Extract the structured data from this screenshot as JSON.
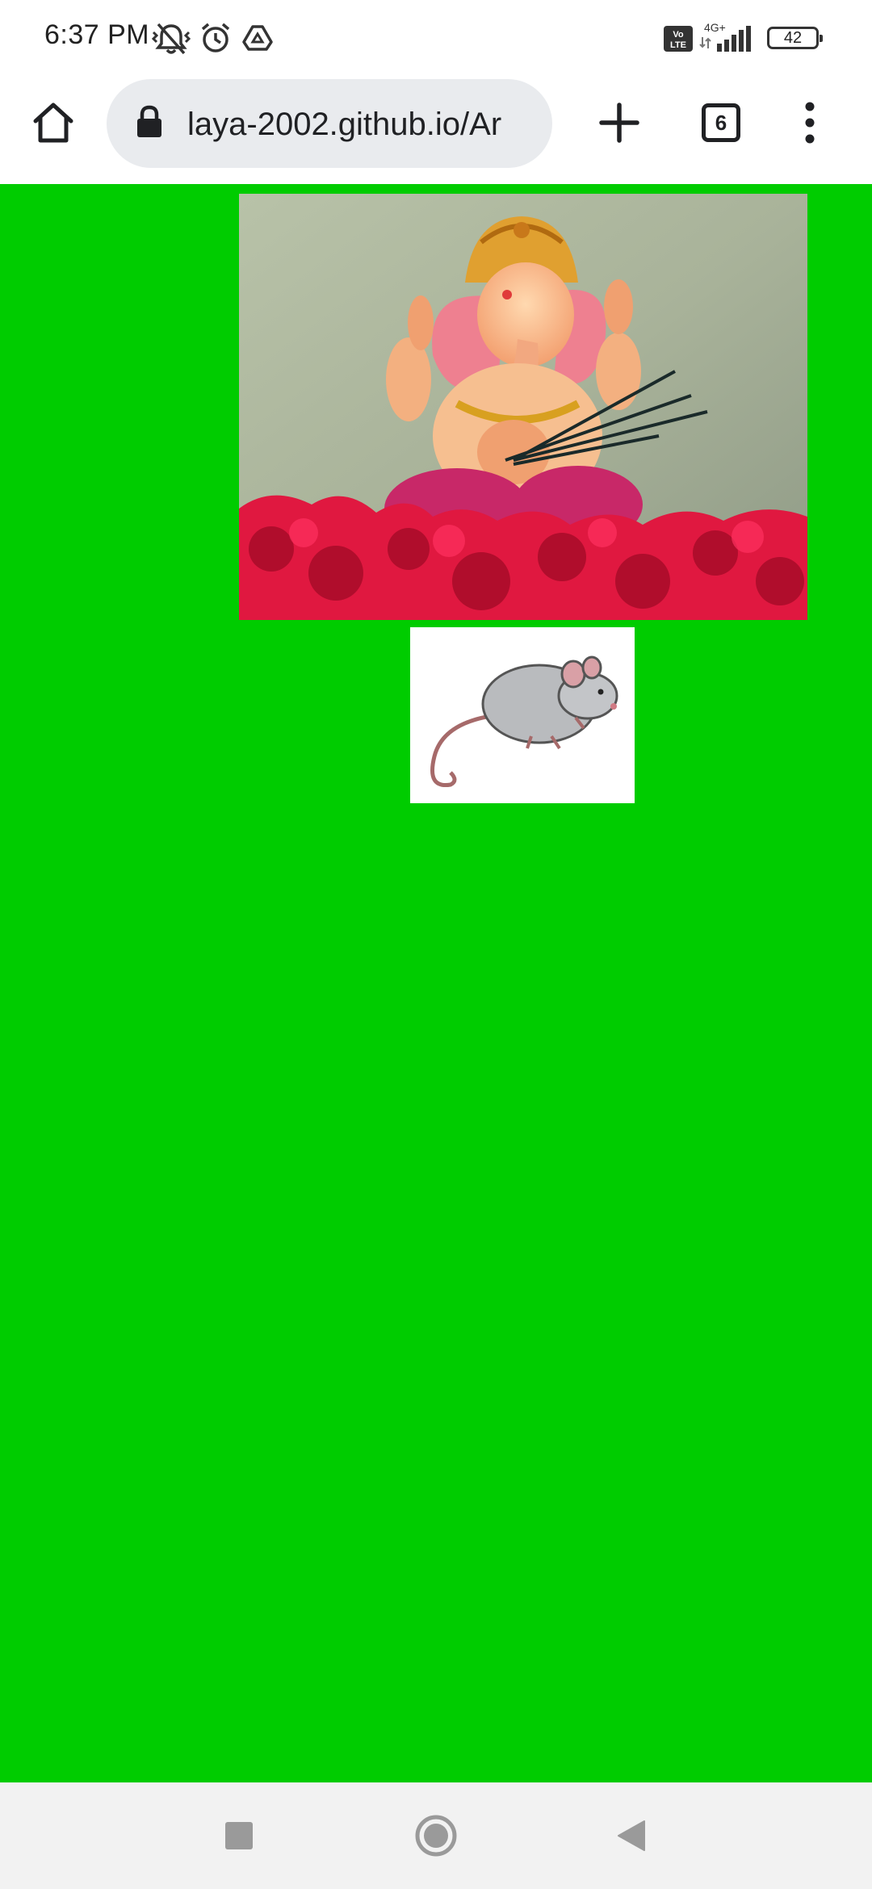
{
  "status_bar": {
    "time": "6:37 PM",
    "network": "4G+",
    "volte": "Vo LTE",
    "battery_level": "42",
    "icons": [
      "mute-vibrate-icon",
      "alarm-icon",
      "drive-icon",
      "volte-icon",
      "signal-icon",
      "battery-icon"
    ]
  },
  "browser": {
    "url": "laya-2002.github.io/Ar",
    "tab_count": "6",
    "icons": [
      "home-icon",
      "lock-icon",
      "new-tab-icon",
      "tab-switcher-icon",
      "menu-icon"
    ]
  },
  "page": {
    "background_color": "#00cc00",
    "images": [
      "ganesha-idol-image",
      "mouse-image"
    ]
  },
  "nav_bar": {
    "icons": [
      "recents-icon",
      "home-nav-icon",
      "back-icon"
    ]
  }
}
